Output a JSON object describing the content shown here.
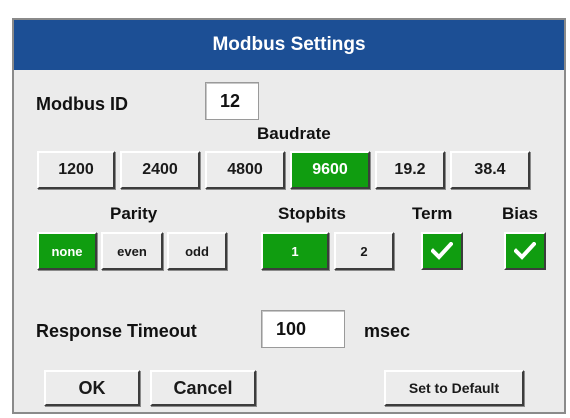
{
  "window": {
    "title": "Modbus Settings"
  },
  "modbus_id": {
    "label": "Modbus ID",
    "value": "12"
  },
  "baudrate": {
    "label": "Baudrate",
    "options": [
      "1200",
      "2400",
      "4800",
      "9600",
      "19.2",
      "38.4"
    ],
    "selected": "9600"
  },
  "parity": {
    "label": "Parity",
    "options": [
      "none",
      "even",
      "odd"
    ],
    "selected": "none"
  },
  "stopbits": {
    "label": "Stopbits",
    "options": [
      "1",
      "2"
    ],
    "selected": "1"
  },
  "term": {
    "label": "Term",
    "checked": true
  },
  "bias": {
    "label": "Bias",
    "checked": true
  },
  "response_timeout": {
    "label": "Response Timeout",
    "value": "100",
    "unit": "msec"
  },
  "buttons": {
    "ok": "OK",
    "cancel": "Cancel",
    "set_default": "Set to Default"
  },
  "colors": {
    "title_bar": "#1c4f95",
    "selected": "#109d10",
    "background": "#ebebeb"
  },
  "icons": {
    "checkbox": "checkmark-icon"
  }
}
